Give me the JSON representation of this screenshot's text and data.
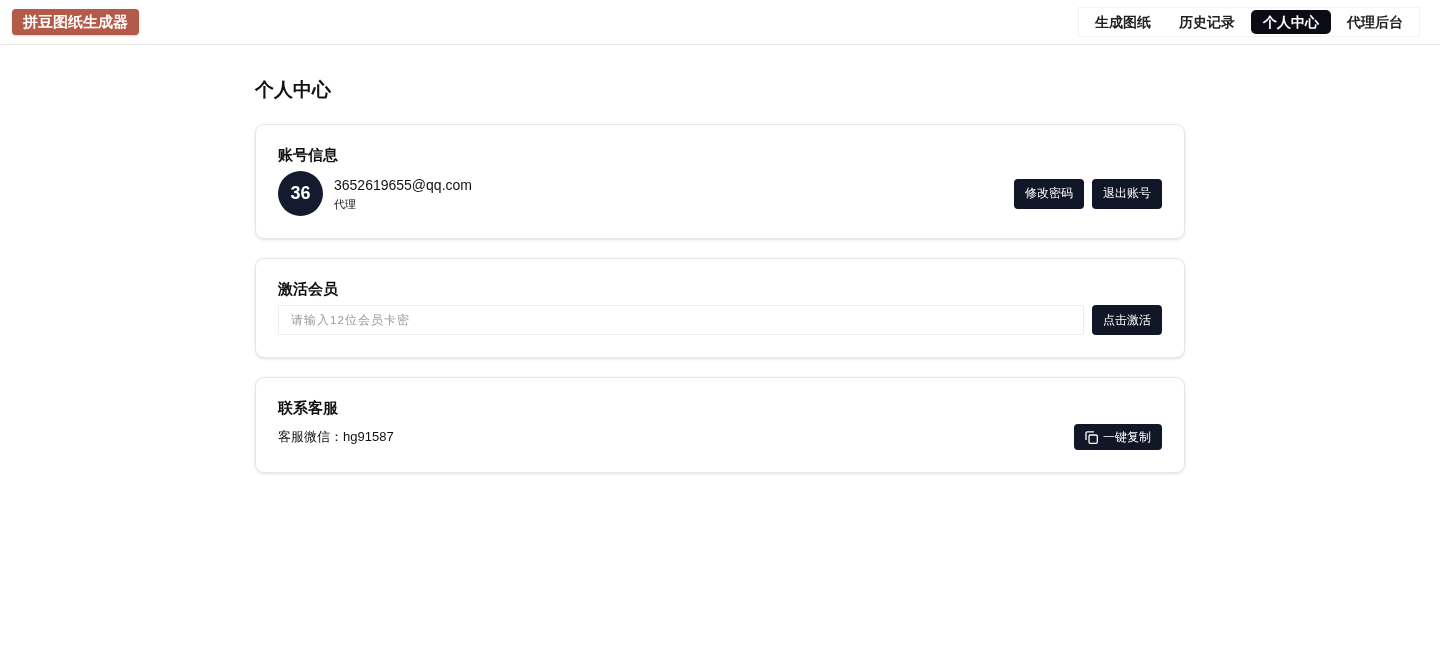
{
  "header": {
    "logo": "拼豆图纸生成器",
    "nav": [
      {
        "label": "生成图纸",
        "selected": false
      },
      {
        "label": "历史记录",
        "selected": false
      },
      {
        "label": "个人中心",
        "selected": true
      },
      {
        "label": "代理后台",
        "selected": false
      }
    ]
  },
  "page_title": "个人中心",
  "account": {
    "title": "账号信息",
    "avatar": "36",
    "email": "3652619655@qq.com",
    "role": "代理",
    "buttons": [
      "修改密码",
      "退出账号"
    ]
  },
  "activate": {
    "title": "激活会员",
    "input": {
      "placeholder": "请输入12位会员卡密"
    },
    "button": "点击激活"
  },
  "support": {
    "title": "联系客服",
    "text": "客服微信：hg91587",
    "button": "一键复制"
  }
}
